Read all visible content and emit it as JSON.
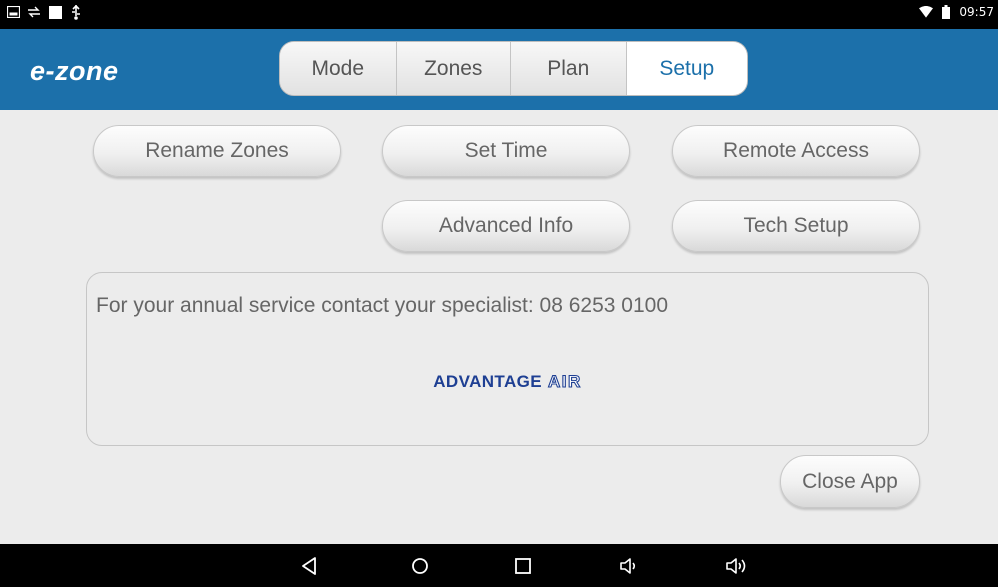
{
  "status_bar": {
    "time": "09:57",
    "left_icons": [
      "screenshot-icon",
      "sync-icon",
      "square-icon",
      "usb-icon"
    ],
    "right_icons": [
      "wifi-icon",
      "battery-icon"
    ]
  },
  "header": {
    "logo": "e-zone",
    "tabs": [
      {
        "label": "Mode",
        "active": false
      },
      {
        "label": "Zones",
        "active": false
      },
      {
        "label": "Plan",
        "active": false
      },
      {
        "label": "Setup",
        "active": true
      }
    ]
  },
  "setup": {
    "buttons": {
      "rename_zones": "Rename Zones",
      "set_time": "Set Time",
      "remote_access": "Remote Access",
      "advanced_info": "Advanced Info",
      "tech_setup": "Tech Setup",
      "close_app": "Close App"
    },
    "service_text": "For your annual service contact your specialist: 08 6253 0100",
    "brand": {
      "word1": "ADVANTAGE",
      "word2": "AIR"
    }
  },
  "nav_bar": {
    "icons": [
      "back-icon",
      "home-icon",
      "recents-icon",
      "volume-down-icon",
      "volume-up-icon"
    ]
  },
  "colors": {
    "header_bg": "#1c70aa",
    "active_tab_text": "#1c70aa",
    "content_bg": "#ececec",
    "brand_blue": "#1e3f93"
  }
}
